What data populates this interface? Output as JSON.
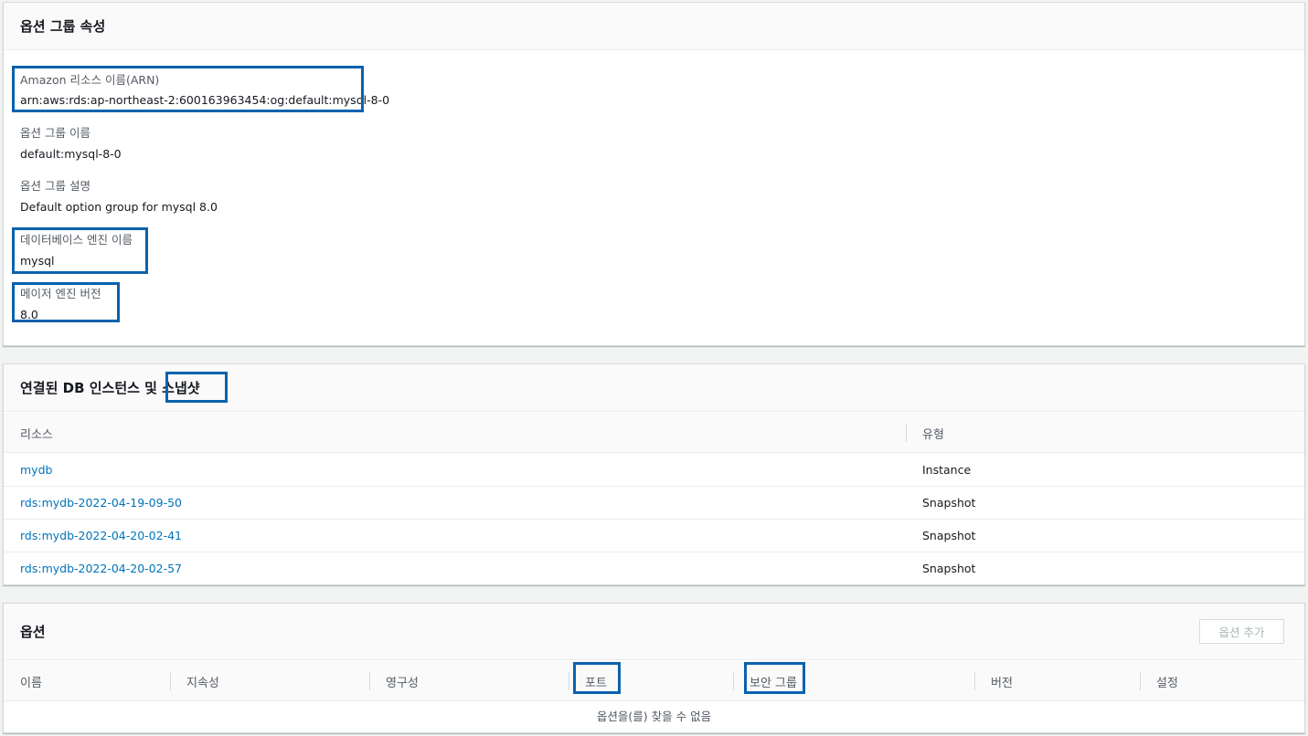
{
  "properties": {
    "title": "옵션 그룹 속성",
    "arn_label": "Amazon 리소스 이름(ARN)",
    "arn_value": "arn:aws:rds:ap-northeast-2:600163963454:og:default:mysql-8-0",
    "name_label": "옵션 그룹 이름",
    "name_value": "default:mysql-8-0",
    "desc_label": "옵션 그룹 설명",
    "desc_value": "Default option group for mysql 8.0",
    "engine_label": "데이터베이스 엔진 이름",
    "engine_value": "mysql",
    "version_label": "메이저 엔진 버전",
    "version_value": "8.0"
  },
  "associated": {
    "title": "연결된 DB 인스턴스 및 스냅샷",
    "columns": [
      "리소스",
      "유형"
    ],
    "rows": [
      {
        "resource": "mydb",
        "type": "Instance"
      },
      {
        "resource": "rds:mydb-2022-04-19-09-50",
        "type": "Snapshot"
      },
      {
        "resource": "rds:mydb-2022-04-20-02-41",
        "type": "Snapshot"
      },
      {
        "resource": "rds:mydb-2022-04-20-02-57",
        "type": "Snapshot"
      }
    ]
  },
  "options": {
    "title": "옵션",
    "add_button": "옵션 추가",
    "columns": [
      "이름",
      "지속성",
      "영구성",
      "포트",
      "보안 그룹",
      "버전",
      "설정"
    ],
    "empty_text": "옵션을(를) 찾을 수 없음"
  },
  "colors": {
    "highlight": "#0a62ad",
    "link": "#0073bb"
  }
}
